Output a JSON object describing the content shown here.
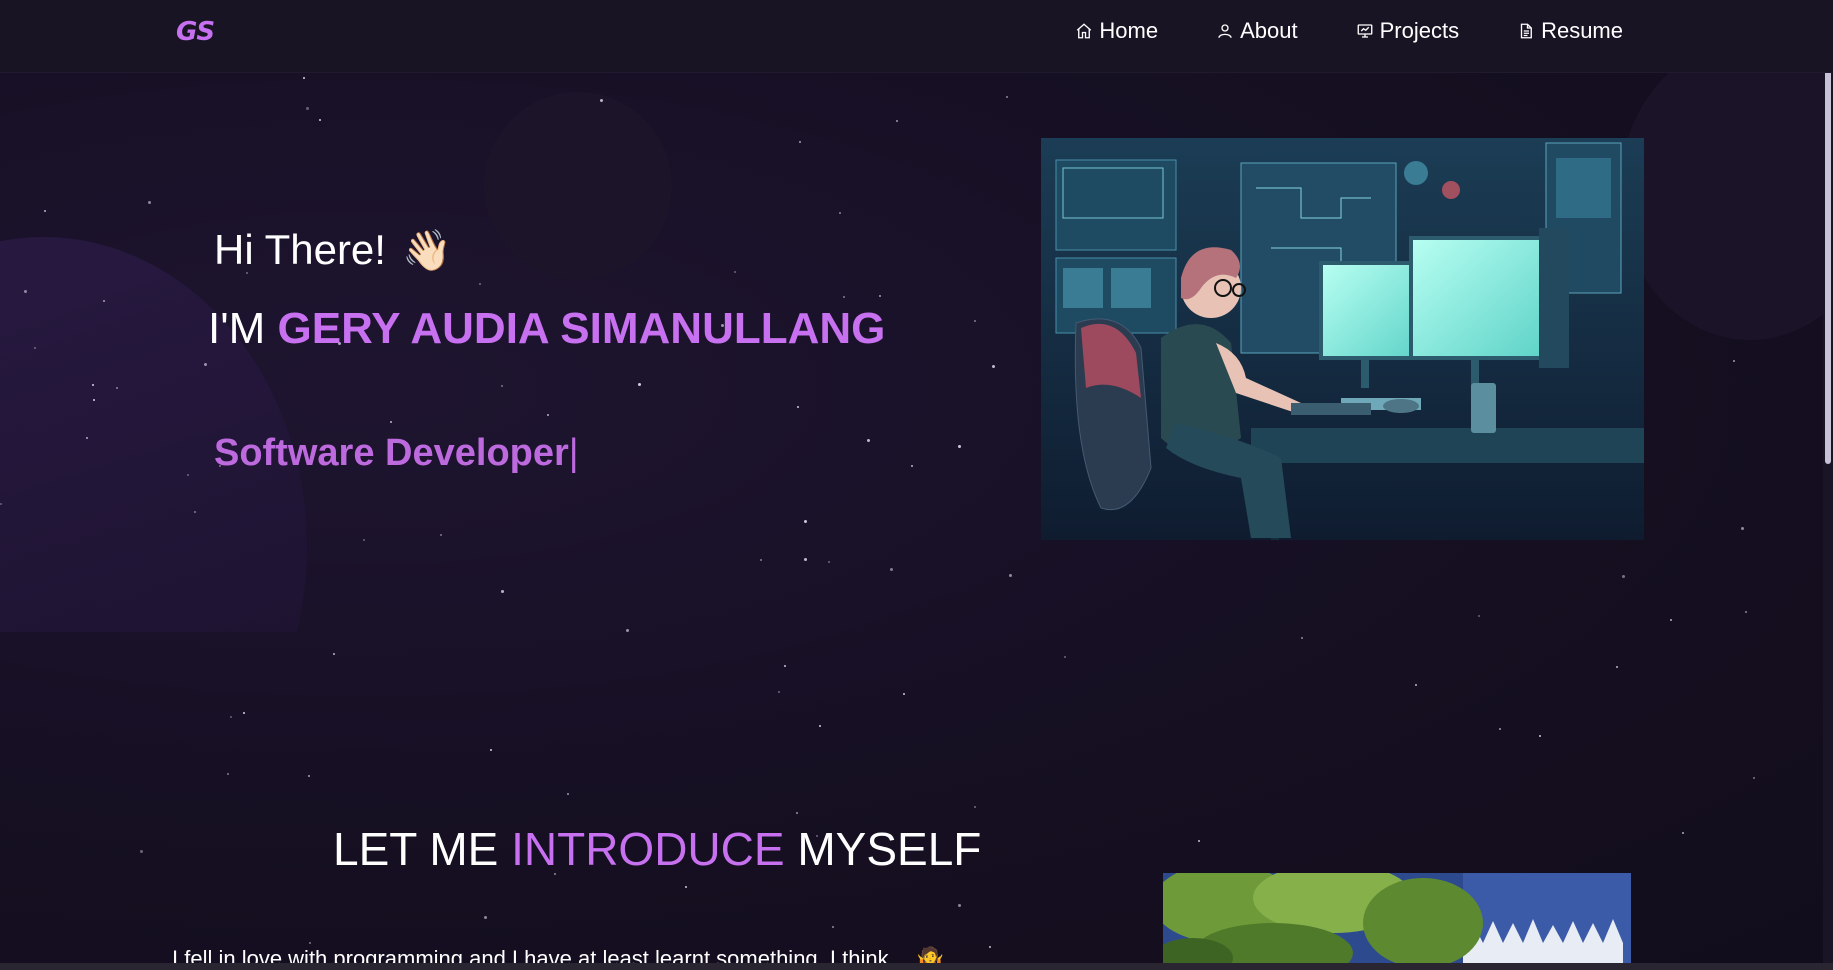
{
  "navbar": {
    "logo": "GS",
    "items": [
      {
        "label": "Home",
        "icon": "home-icon"
      },
      {
        "label": "About",
        "icon": "user-icon"
      },
      {
        "label": "Projects",
        "icon": "presentation-icon"
      },
      {
        "label": "Resume",
        "icon": "document-icon"
      }
    ]
  },
  "hero": {
    "greeting": "Hi There!",
    "wave_emoji": "👋🏻",
    "name_prefix": "I'M",
    "name": "GERY AUDIA SIMANULLANG",
    "role": "Software Developer",
    "cursor": "|"
  },
  "intro": {
    "title_pre": "LET ME",
    "title_accent": "INTRODUCE",
    "title_post": "MYSELF",
    "text": "I fell in love with programming and I have at least learnt something, I think… 🤷"
  },
  "colors": {
    "accent": "#c770f0",
    "background": "#160f22",
    "navbar": "#181424"
  }
}
